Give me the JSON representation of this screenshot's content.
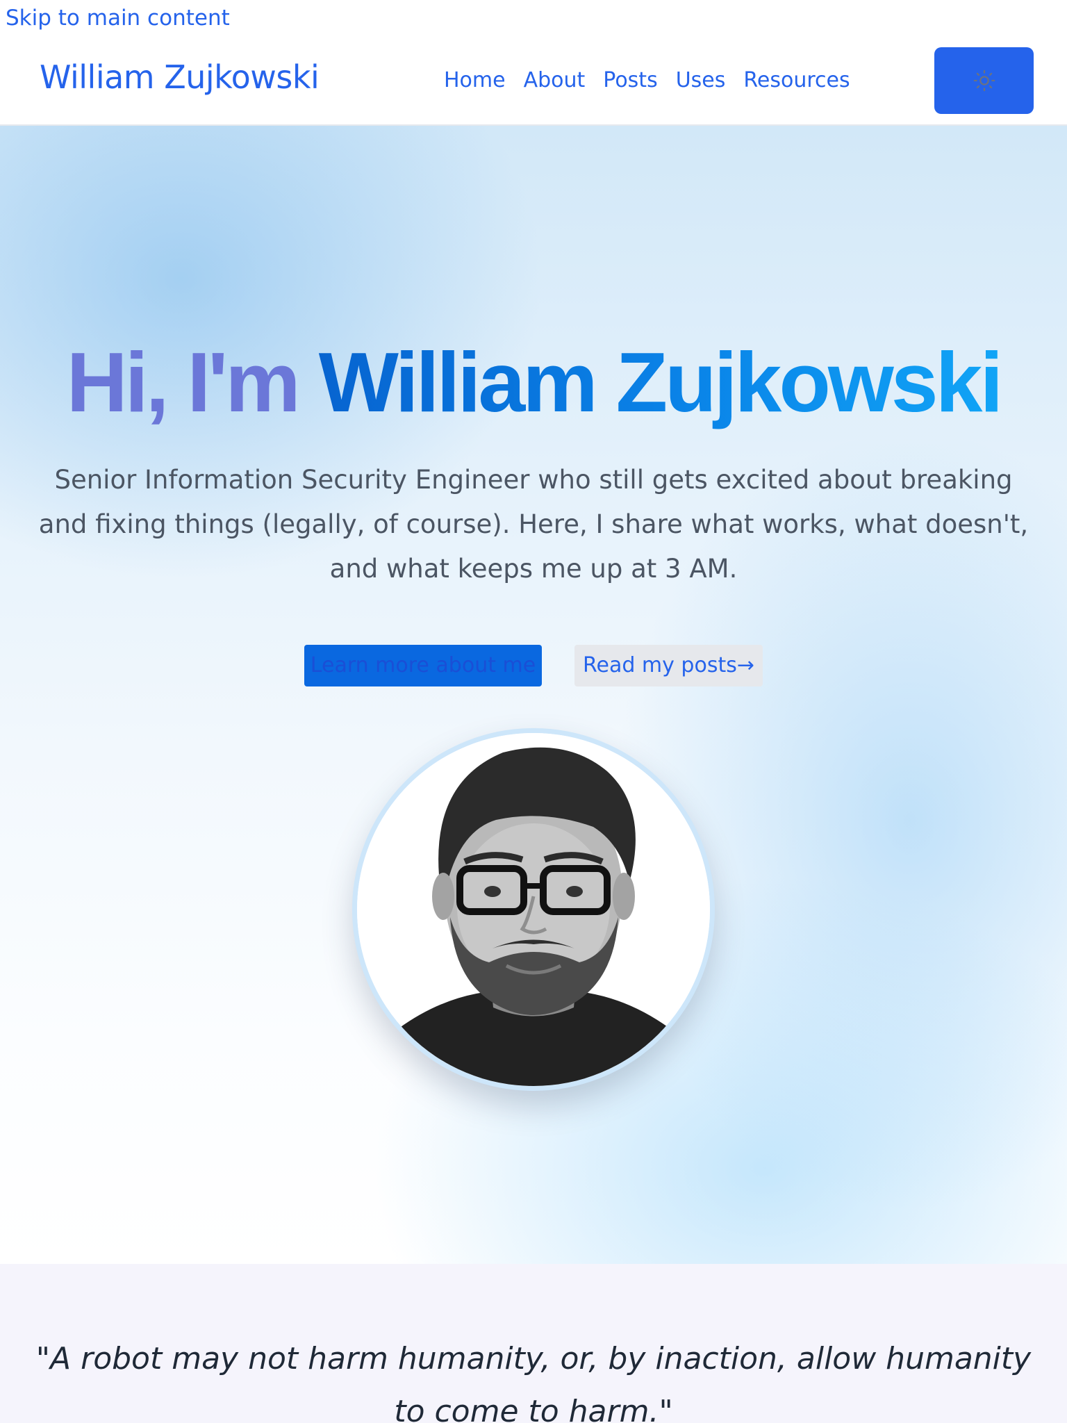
{
  "skip_link": "Skip to main content",
  "header": {
    "brand": "William Zujkowski",
    "nav": [
      "Home",
      "About",
      "Posts",
      "Uses",
      "Resources"
    ],
    "theme_toggle_icon": "sun-icon"
  },
  "hero": {
    "title_greeting": "Hi, I'm ",
    "title_name": "William Zujkowski",
    "subtitle": "Senior Information Security Engineer who still gets excited about breaking and fixing things (legally, of course). Here, I share what works, what doesn't, and what keeps me up at 3 AM.",
    "primary_button": "Learn more about me",
    "secondary_button": "Read my posts",
    "secondary_button_icon": "arrow-right-icon",
    "avatar": "portrait-photo"
  },
  "quote": {
    "text": "\"A robot may not harm humanity, or, by inaction, allow humanity to come to harm.\""
  },
  "colors": {
    "accent": "#2563eb",
    "greeting": "#6b77d8",
    "name_gradient_start": "#0764d0",
    "name_gradient_end": "#11a4f6",
    "body_text": "#4b5563",
    "quote_bg": "#f5f4fc"
  }
}
